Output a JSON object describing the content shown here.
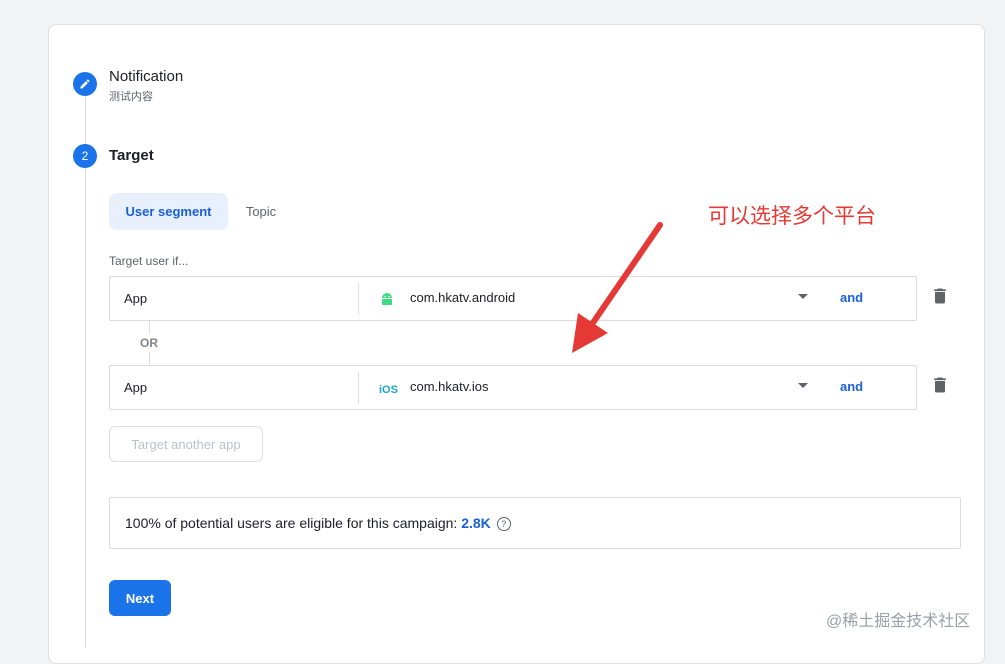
{
  "steps": [
    {
      "number": "",
      "title": "Notification",
      "subtitle": "测试内容"
    },
    {
      "number": "2",
      "title": "Target"
    }
  ],
  "tabs": {
    "user_segment": "User segment",
    "topic": "Topic"
  },
  "target_label": "Target user if...",
  "conditions": [
    {
      "field": "App",
      "platform_icon": "android-icon",
      "value": "com.hkatv.android",
      "and_label": "and"
    },
    {
      "field": "App",
      "platform_icon": "ios-icon",
      "value": "com.hkatv.ios",
      "and_label": "and"
    }
  ],
  "or_label": "OR",
  "target_another_app": "Target another app",
  "eligibility": {
    "text": "100% of potential users are eligible for this campaign: ",
    "count": "2.8K"
  },
  "next_button": "Next",
  "annotation": "可以选择多个平台",
  "watermark": "@稀土掘金技术社区",
  "colors": {
    "accent": "#1a73e8",
    "annotation": "#e53935",
    "android": "#3ddc84",
    "ios": "#1aa5c9"
  }
}
